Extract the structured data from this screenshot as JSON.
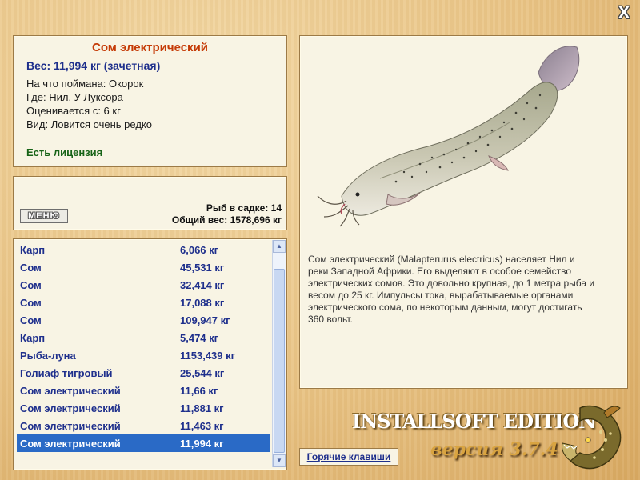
{
  "window": {
    "close_label": "X"
  },
  "fish_info": {
    "name": "Сом электрический",
    "weight": "Вес: 11,994 кг (зачетная)",
    "bait": "На что поймана: Окорок",
    "location": "Где: Нил, У Луксора",
    "rated_from": "Оценивается с: 6 кг",
    "rarity": "Вид: Ловится очень редко",
    "license": "Есть лицензия"
  },
  "cage": {
    "menu_label": "МЕНЮ",
    "fish_count": "Рыб в садке: 14",
    "total_weight": "Общий вес: 1578,696 кг"
  },
  "catch_list": {
    "rows": [
      {
        "name": "Карп",
        "weight": "6,066 кг"
      },
      {
        "name": "Сом",
        "weight": "45,531 кг"
      },
      {
        "name": "Сом",
        "weight": "32,414 кг"
      },
      {
        "name": "Сом",
        "weight": "17,088 кг"
      },
      {
        "name": "Сом",
        "weight": "109,947 кг"
      },
      {
        "name": "Карп",
        "weight": "5,474 кг"
      },
      {
        "name": "Рыба-луна",
        "weight": "1153,439 кг"
      },
      {
        "name": "Голиаф тигровый",
        "weight": "25,544 кг"
      },
      {
        "name": "Сом электрический",
        "weight": "11,66 кг"
      },
      {
        "name": "Сом электрический",
        "weight": "11,881 кг"
      },
      {
        "name": "Сом электрический",
        "weight": "11,463 кг"
      },
      {
        "name": "Сом электрический",
        "weight": "11,994 кг"
      }
    ],
    "selected_index": 11,
    "scroll_position": 0.95
  },
  "description": "Сом электрический (Malapterurus electricus) населяет Нил и реки Западной Африки. Его выделяют в особое семейство электрических сомов. Это довольно крупная, до 1 метра рыба и весом до 25 кг. Импульсы тока, вырабатываемые органами электрического сома, по некоторым данным, могут достигать 360 вольт.",
  "footer": {
    "hotkeys_label": "Горячие клавиши",
    "edition": "INSTALLSOFT EDITION",
    "version": "версия 3.7.4"
  },
  "colors": {
    "title": "#c53b07",
    "list_text": "#1e2f8c",
    "selection": "#2a6ac6",
    "license": "#176317"
  }
}
